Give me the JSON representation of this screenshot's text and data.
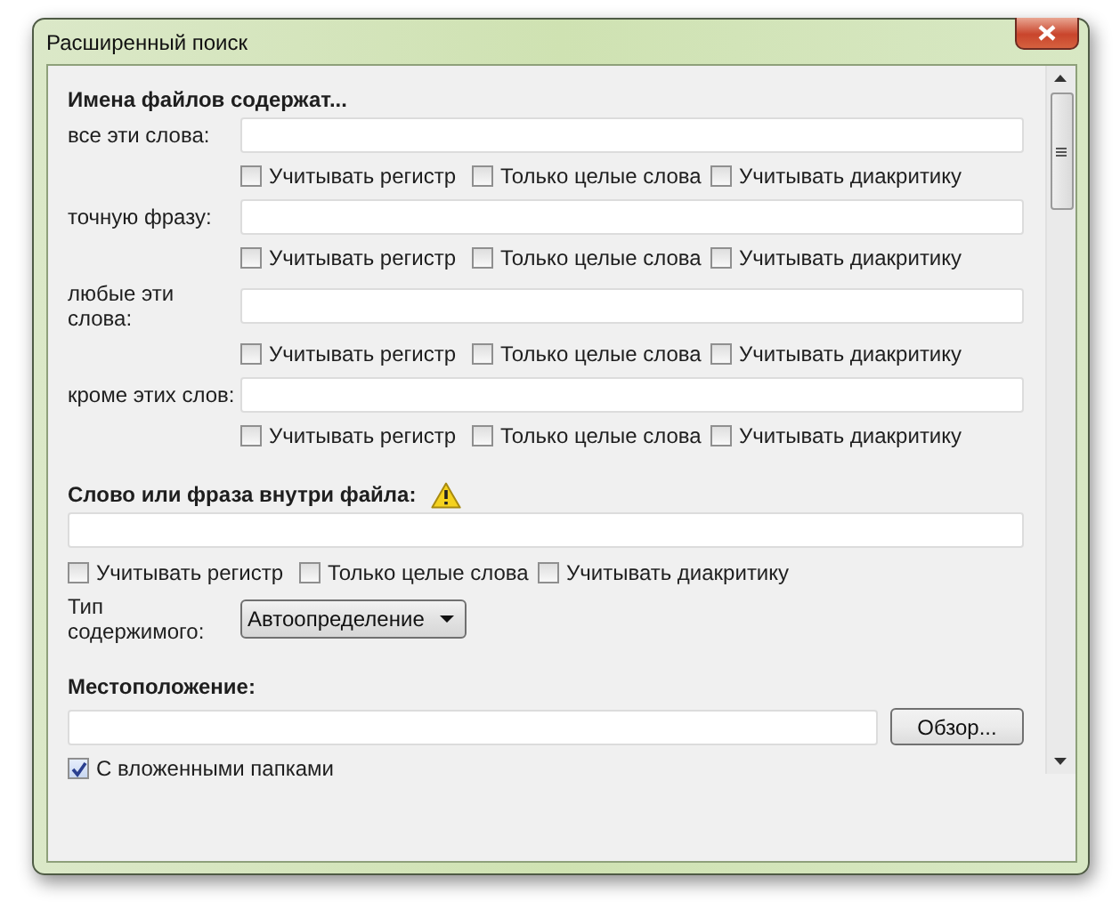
{
  "window": {
    "title": "Расширенный поиск"
  },
  "filename_section": {
    "heading": "Имена файлов содержат...",
    "rows": [
      {
        "label": "все эти слова:",
        "options": [
          {
            "label": "Учитывать регистр",
            "checked": false
          },
          {
            "label": "Только целые слова",
            "checked": false
          },
          {
            "label": "Учитывать диакритику",
            "checked": false
          }
        ]
      },
      {
        "label": "точную фразу:",
        "options": [
          {
            "label": "Учитывать регистр",
            "checked": false
          },
          {
            "label": "Только целые слова",
            "checked": false
          },
          {
            "label": "Учитывать диакритику",
            "checked": false
          }
        ]
      },
      {
        "label": "любые эти слова:",
        "options": [
          {
            "label": "Учитывать регистр",
            "checked": false
          },
          {
            "label": "Только целые слова",
            "checked": false
          },
          {
            "label": "Учитывать диакритику",
            "checked": false
          }
        ]
      },
      {
        "label": "кроме этих слов:",
        "options": [
          {
            "label": "Учитывать регистр",
            "checked": false
          },
          {
            "label": "Только целые слова",
            "checked": false
          },
          {
            "label": "Учитывать диакритику",
            "checked": false
          }
        ]
      }
    ]
  },
  "content_section": {
    "heading": "Слово или фраза внутри файла:",
    "options": [
      {
        "label": "Учитывать регистр",
        "checked": false
      },
      {
        "label": "Только целые слова",
        "checked": false
      },
      {
        "label": "Учитывать диакритику",
        "checked": false
      }
    ],
    "content_type": {
      "label": "Тип содержимого:",
      "value": "Автоопределение"
    }
  },
  "location_section": {
    "heading": "Местоположение:",
    "browse_button": "Обзор...",
    "subfolders": {
      "label": "С вложенными папками",
      "checked": true
    }
  }
}
